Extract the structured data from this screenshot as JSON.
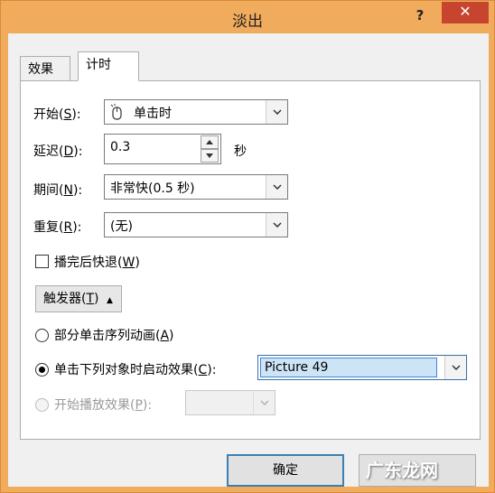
{
  "window": {
    "title": "淡出",
    "help": "?",
    "close": "✕"
  },
  "tabs": [
    {
      "label": "效果"
    },
    {
      "label": "计时"
    }
  ],
  "start": {
    "label_pre": "开始(",
    "label_key": "S",
    "label_post": "):",
    "value": "单击时"
  },
  "delay": {
    "label_pre": "延迟(",
    "label_key": "D",
    "label_post": "):",
    "value": "0.3",
    "unit": "秒"
  },
  "duration": {
    "label_pre": "期间(",
    "label_key": "N",
    "label_post": "):",
    "value": "非常快(0.5 秒)"
  },
  "repeat": {
    "label_pre": "重复(",
    "label_key": "R",
    "label_post": "):",
    "value": "(无)"
  },
  "rewind": {
    "label_pre": "播完后快退(",
    "label_key": "W",
    "label_post": ")",
    "checked": false
  },
  "trigger": {
    "label_pre": "触发器(",
    "label_key": "T",
    "label_post": ")",
    "arrow": "▲▼"
  },
  "radios": {
    "sequence": {
      "label_pre": "部分单击序列动画(",
      "label_key": "A",
      "label_post": ")",
      "selected": false
    },
    "on_click": {
      "label_pre": "单击下列对象时启动效果(",
      "label_key": "C",
      "label_post": "):",
      "selected": true,
      "value": "Picture 49"
    },
    "on_play": {
      "label_pre": "开始播放效果(",
      "label_key": "P",
      "label_post": "):",
      "selected": false,
      "disabled": true,
      "value": ""
    }
  },
  "buttons": {
    "ok": "确定"
  },
  "watermark": "广东龙网"
}
